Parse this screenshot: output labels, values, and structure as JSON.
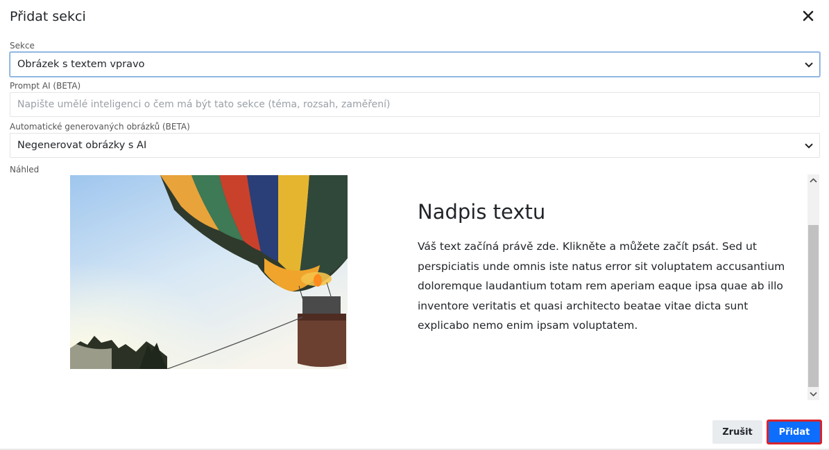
{
  "dialog": {
    "title": "Přidat sekci"
  },
  "fields": {
    "section": {
      "label": "Sekce",
      "value": "Obrázek s textem vpravo"
    },
    "prompt": {
      "label": "Prompt AI (BETA)",
      "placeholder": "Napište umělé inteligenci o čem má být tato sekce (téma, rozsah, zaměření)",
      "value": ""
    },
    "images": {
      "label": "Automatické generovaných obrázků (BETA)",
      "value": "Negenerovat obrázky s AI"
    }
  },
  "preview": {
    "label": "Náhled",
    "heading": "Nadpis textu",
    "text": "Váš text začíná právě zde. Klikněte a můžete začít psát. Sed ut perspiciatis unde omnis iste natus error sit voluptatem accusantium doloremque laudantium totam rem aperiam eaque ipsa quae ab illo inventore veritatis et quasi architecto beatae vitae dicta sunt explicabo nemo enim ipsam voluptatem.",
    "image": "hot-air-balloon-photo"
  },
  "buttons": {
    "cancel": "Zrušit",
    "add": "Přidat"
  },
  "colors": {
    "primary": "#0d6efd",
    "highlight": "#d9232d",
    "cancel_bg": "#e9ecef"
  },
  "icons": {
    "close": "close-icon",
    "chevron": "chevron-down-icon"
  }
}
